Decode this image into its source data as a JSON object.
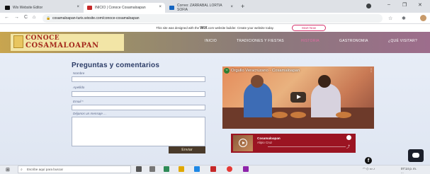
{
  "browser": {
    "tabs": [
      {
        "label": "Wix Website Editor",
        "icon": "wix-icon",
        "color": "#111111"
      },
      {
        "label": "INICIO | Conoce Cosamaloapan",
        "icon": "site-icon",
        "color": "#c62828"
      },
      {
        "label": "Correo: ZARRABAL LORTIA SOFIA",
        "icon": "outlook-icon",
        "color": "#1565c0"
      }
    ],
    "new_tab_symbol": "+",
    "close_symbol": "×",
    "url": "cosamaloapan-turis.wixsite.com/conoce-cosamaloapan",
    "window_controls": [
      "–",
      "❐",
      "✕"
    ]
  },
  "wix_banner": {
    "text_before": "This site was designed with the ",
    "brand": "WiX",
    "text_after": ".com website builder. Create your website today.",
    "cta": "Start Now"
  },
  "site": {
    "logo_line1": "CONOCE",
    "logo_line2": "COSAMALOAPAN",
    "nav": [
      {
        "label": "INICIO",
        "active": false
      },
      {
        "label": "TRADICIONES Y FIESTAS",
        "active": false
      },
      {
        "label": "HISTORIA",
        "active": true
      },
      {
        "label": "GASTRONOMIA",
        "active": false
      },
      {
        "label": "¿QUÉ VISITAR?",
        "active": false
      }
    ],
    "accent": "#e66aa5"
  },
  "form": {
    "title": "Preguntas y comentarios",
    "name_label": "Nombre",
    "surname_label": "Apellido",
    "email_label": "Email *",
    "message_label": "Déjanos un mensaje ...",
    "submit_label": "Enviar"
  },
  "video": {
    "title": "Orgullo Veracruzano - Cosamaloapan",
    "channel_badge": "TV"
  },
  "mini_player": {
    "title": "Cosamaloapan",
    "subtitle": "Alipio Cruz"
  },
  "social": {
    "facebook_glyph": "f"
  },
  "taskbar": {
    "search_placeholder": "Escribe aquí para buscar",
    "time": "07:14 p. m.",
    "date": "..."
  }
}
